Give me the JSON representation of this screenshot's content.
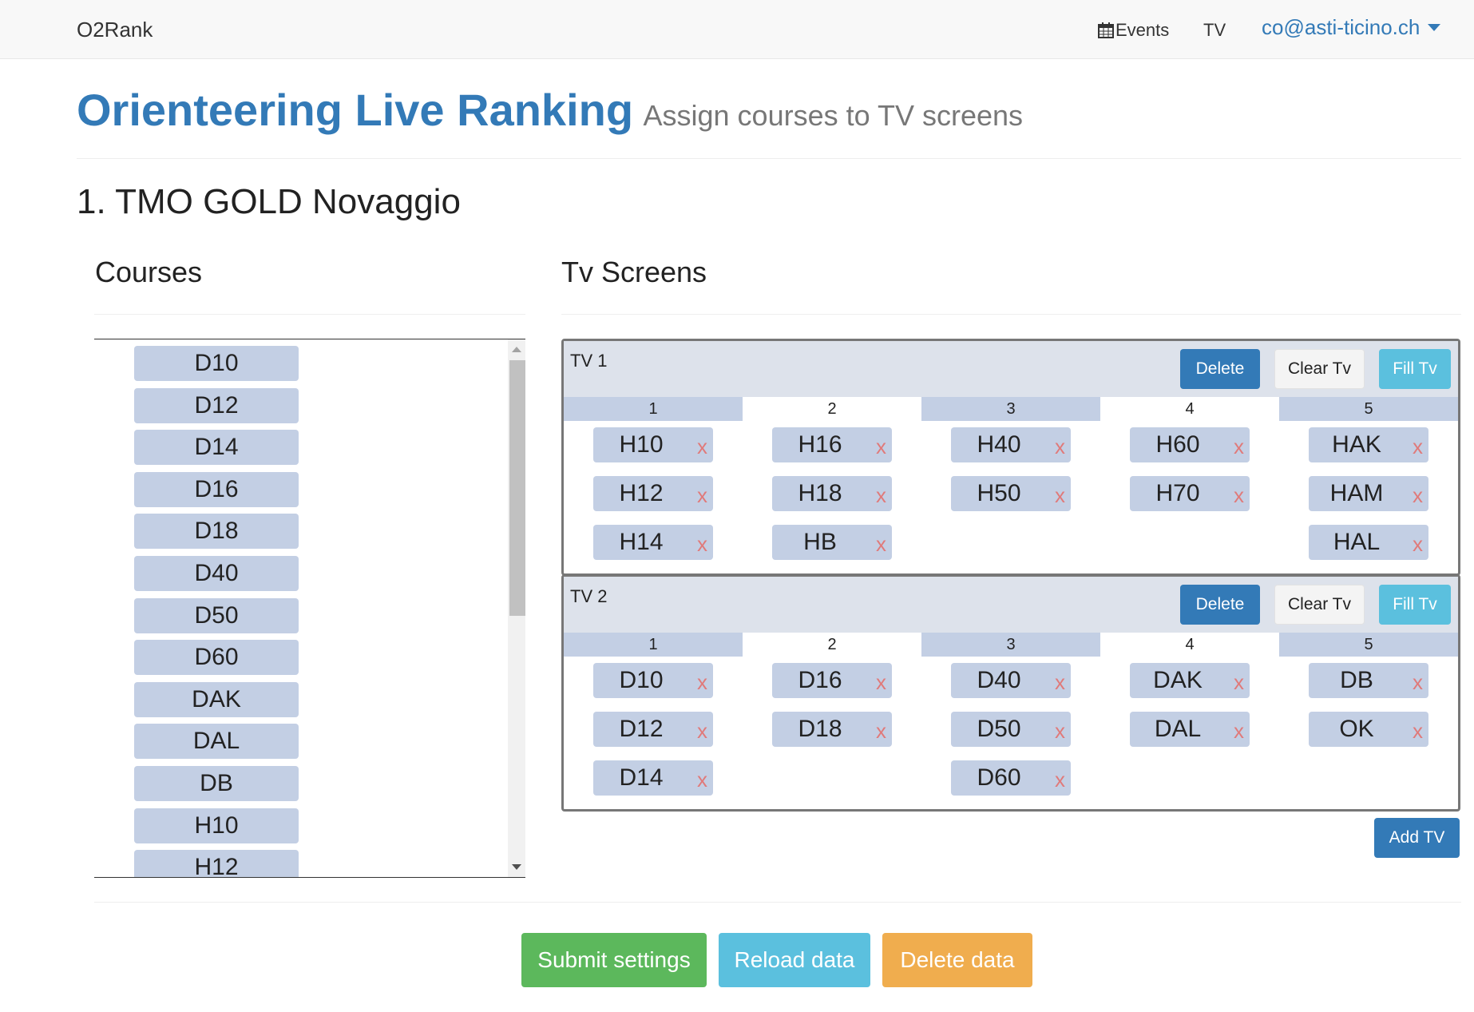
{
  "navbar": {
    "brand": "O2Rank",
    "events_label": "Events",
    "tv_label": "TV",
    "user_email": "co@asti-ticino.ch"
  },
  "header": {
    "title": "Orienteering Live Ranking",
    "subtitle": "Assign courses to TV screens"
  },
  "event_title": "1. TMO GOLD Novaggio",
  "courses": {
    "heading": "Courses",
    "items": [
      "D10",
      "D12",
      "D14",
      "D16",
      "D18",
      "D40",
      "D50",
      "D60",
      "DAK",
      "DAL",
      "DB",
      "H10",
      "H12"
    ]
  },
  "tv_screens": {
    "heading": "Tv Screens",
    "delete_label": "Delete",
    "clear_label": "Clear Tv",
    "fill_label": "Fill Tv",
    "remove_label": "x",
    "column_numbers": [
      "1",
      "2",
      "3",
      "4",
      "5"
    ],
    "tvs": [
      {
        "name": "TV 1",
        "columns": [
          [
            "H10",
            "H12",
            "H14"
          ],
          [
            "H16",
            "H18",
            "HB"
          ],
          [
            "H40",
            "H50"
          ],
          [
            "H60",
            "H70"
          ],
          [
            "HAK",
            "HAM",
            "HAL"
          ]
        ]
      },
      {
        "name": "TV 2",
        "columns": [
          [
            "D10",
            "D12",
            "D14"
          ],
          [
            "D16",
            "D18"
          ],
          [
            "D40",
            "D50",
            "D60"
          ],
          [
            "DAK",
            "DAL"
          ],
          [
            "DB",
            "OK"
          ]
        ]
      }
    ],
    "add_tv_label": "Add TV"
  },
  "actions": {
    "submit": "Submit settings",
    "reload": "Reload data",
    "delete": "Delete data"
  },
  "colors": {
    "primary": "#337ab7",
    "success": "#5cb85c",
    "info": "#5bc0de",
    "warning": "#f0ad4e",
    "chip": "#c3cfe4",
    "remove_x": "#e07a7a"
  }
}
